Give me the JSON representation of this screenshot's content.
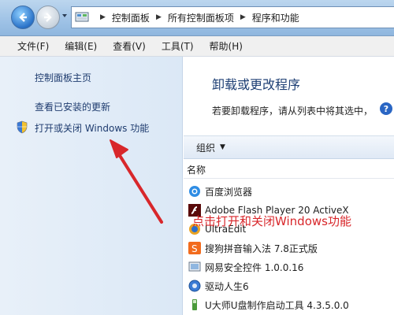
{
  "address_bar": {
    "breadcrumbs": [
      "控制面板",
      "所有控制面板项",
      "程序和功能"
    ]
  },
  "menu": [
    "文件(F)",
    "编辑(E)",
    "查看(V)",
    "工具(T)",
    "帮助(H)"
  ],
  "left_pane": {
    "home_link": "控制面板主页",
    "updates_link": "查看已安装的更新",
    "features_link": "打开或关闭 Windows 功能"
  },
  "right_pane": {
    "title": "卸载或更改程序",
    "description": "若要卸载程序，请从列表中将其选中，",
    "organize_label": "组织",
    "column_name": "名称",
    "programs": [
      {
        "name": "百度浏览器",
        "icon": "baidu-browser-icon"
      },
      {
        "name": "Adobe Flash Player 20 ActiveX",
        "icon": "flash-icon"
      },
      {
        "name": "UltraEdit",
        "icon": "ultraedit-icon"
      },
      {
        "name": "搜狗拼音输入法 7.8正式版",
        "icon": "sogou-icon"
      },
      {
        "name": "网易安全控件 1.0.0.16",
        "icon": "netease-icon"
      },
      {
        "name": "驱动人生6",
        "icon": "driver-icon"
      },
      {
        "name": "U大师U盘制作启动工具 4.3.5.0.0",
        "icon": "usb-tool-icon"
      }
    ]
  },
  "annotation": {
    "text": "点击打开和关闭Windows功能",
    "color": "#d8272b"
  },
  "colors": {
    "link": "#1f3c6f",
    "title": "#1e3f74"
  }
}
